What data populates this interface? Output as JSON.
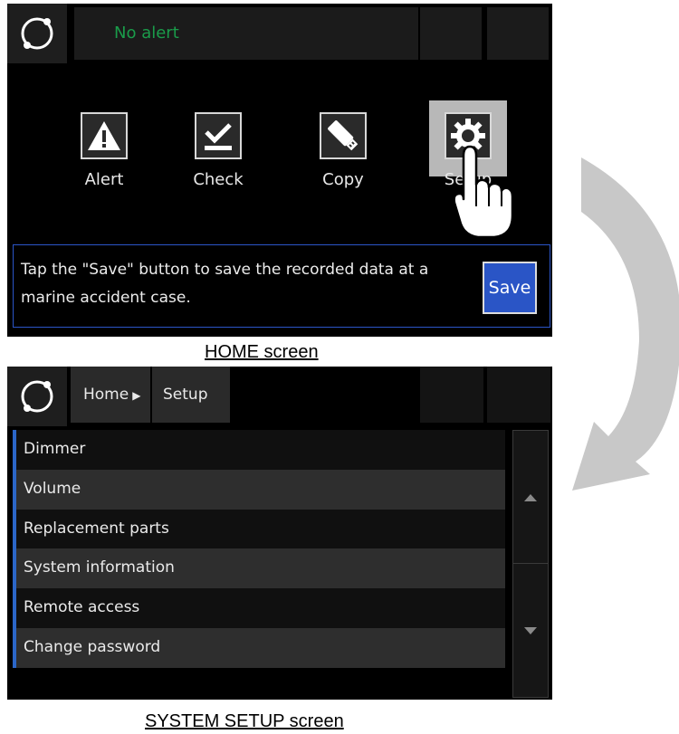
{
  "home": {
    "alert_text": "No alert",
    "icons": [
      {
        "label": "Alert",
        "icon": "warning-triangle-icon"
      },
      {
        "label": "Check",
        "icon": "checkbox-icon"
      },
      {
        "label": "Copy",
        "icon": "usb-drive-icon"
      },
      {
        "label": "Setup",
        "icon": "gear-icon"
      }
    ],
    "message": "Tap the \"Save\" button to save the recorded data at a marine accident case.",
    "save_label": "Save",
    "caption": "HOME screen"
  },
  "setup": {
    "breadcrumb_home": "Home",
    "breadcrumb_current": "Setup",
    "items": [
      {
        "label": "Dimmer"
      },
      {
        "label": "Volume"
      },
      {
        "label": "Replacement parts"
      },
      {
        "label": "System information"
      },
      {
        "label": "Remote access"
      },
      {
        "label": "Change password"
      }
    ],
    "caption": "SYSTEM SETUP screen"
  },
  "colors": {
    "alert_green": "#1a9c4a",
    "accent_blue": "#2a55c6",
    "screen_bg": "#000000",
    "flow_arrow": "#c8c8c8"
  }
}
